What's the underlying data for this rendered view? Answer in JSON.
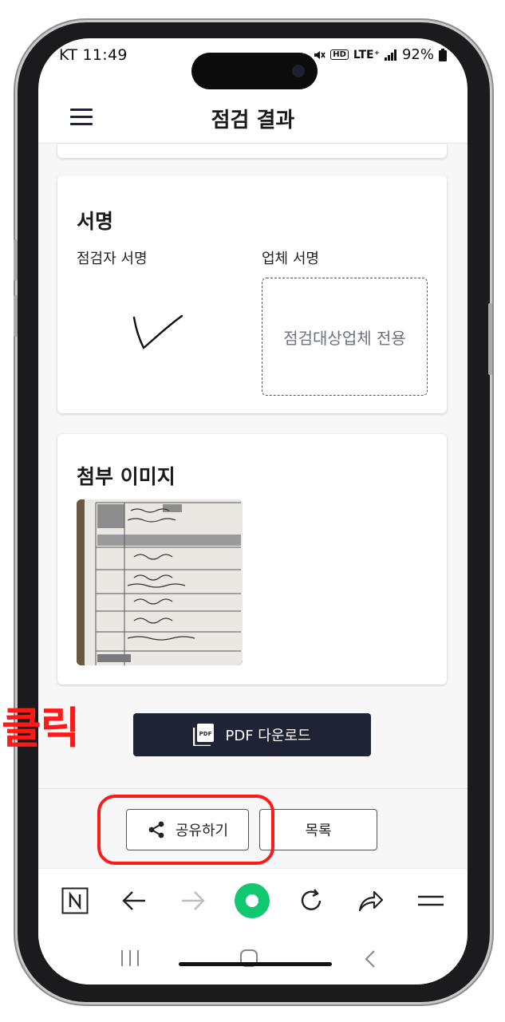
{
  "status_bar": {
    "carrier_time": "KT 11:49",
    "network": "LTE⁺",
    "battery": "92%"
  },
  "header": {
    "title": "점검 결과"
  },
  "signature_card": {
    "title": "서명",
    "inspector_label": "점검자 서명",
    "company_label": "업체 서명",
    "company_placeholder": "점검대상업체 전용"
  },
  "attachment_card": {
    "title": "첨부 이미지"
  },
  "actions": {
    "pdf_download": "PDF 다운로드",
    "share": "공유하기",
    "list": "목록"
  },
  "annotation": {
    "click_label": "클릭",
    "color": "#ff1a1a"
  },
  "colors": {
    "primary_dark": "#1e2436",
    "accent_green": "#11c76f"
  },
  "icons": [
    "hamburger-icon",
    "pdf-icon",
    "share-icon",
    "naver-n-icon",
    "back-arrow-icon",
    "forward-arrow-icon",
    "green-home-icon",
    "reload-icon",
    "share-arrow-icon",
    "menu-icon",
    "recent-apps-icon",
    "home-nav-icon",
    "back-nav-icon"
  ]
}
